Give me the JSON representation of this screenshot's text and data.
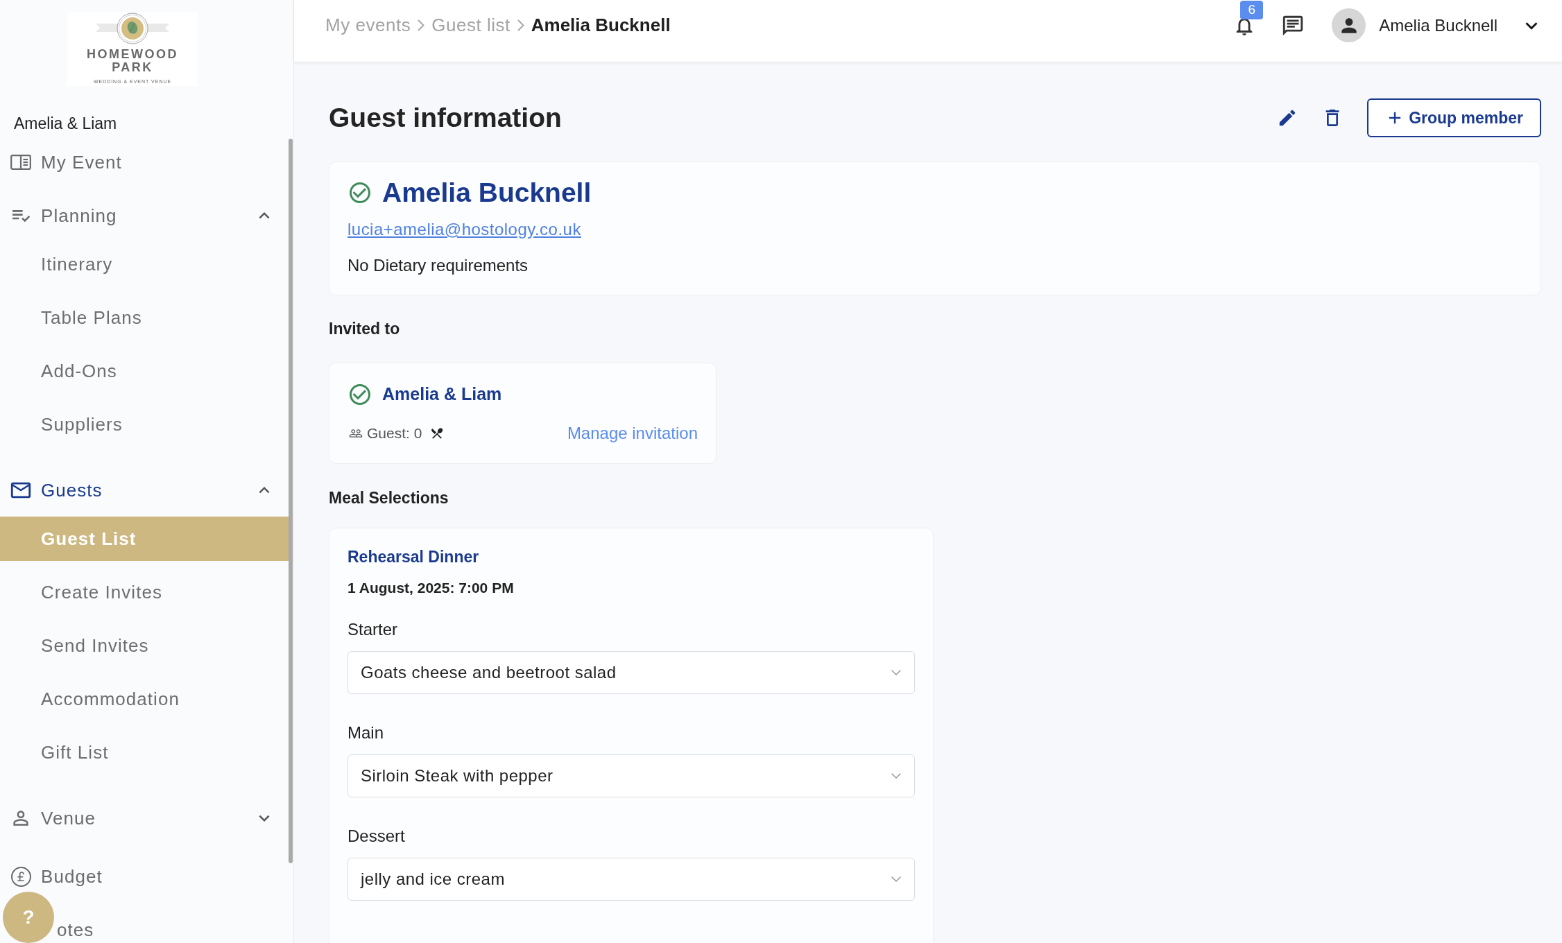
{
  "sidebar": {
    "logo": {
      "name_lines": [
        "HOMEWOOD",
        "PARK"
      ],
      "tagline": "WEDDING & EVENT VENUE"
    },
    "event_name": "Amelia & Liam",
    "items": [
      {
        "kind": "link",
        "label": "My Event",
        "selected": false
      },
      {
        "kind": "group",
        "label": "Planning",
        "selected": false,
        "expanded": true,
        "children": [
          {
            "label": "Itinerary",
            "selected": false
          },
          {
            "label": "Table Plans",
            "selected": false
          },
          {
            "label": "Add-Ons",
            "selected": false
          },
          {
            "label": "Suppliers",
            "selected": false
          }
        ]
      },
      {
        "kind": "group",
        "label": "Guests",
        "selected": true,
        "expanded": true,
        "children": [
          {
            "label": "Guest List",
            "selected": true
          },
          {
            "label": "Create Invites",
            "selected": false
          },
          {
            "label": "Send Invites",
            "selected": false
          },
          {
            "label": "Accommodation",
            "selected": false
          },
          {
            "label": "Gift List",
            "selected": false
          }
        ]
      },
      {
        "kind": "group",
        "label": "Venue",
        "selected": false,
        "expanded": false
      },
      {
        "kind": "link",
        "label": "Budget",
        "selected": false
      },
      {
        "kind": "covered",
        "label": "otes",
        "selected": false
      }
    ],
    "help_button": {
      "label": "?"
    }
  },
  "header": {
    "breadcrumb": [
      {
        "label": "My events",
        "current": false
      },
      {
        "label": "Guest list",
        "current": false
      },
      {
        "label": "Amelia Bucknell",
        "current": true
      }
    ],
    "notification_count": "6",
    "user_name": "Amelia Bucknell"
  },
  "page": {
    "title": "Guest information",
    "add_button": "Group member"
  },
  "guest": {
    "name": "Amelia Bucknell",
    "confirmed": true,
    "email": "lucia+amelia@hostology.co.uk",
    "dietary": "No Dietary requirements"
  },
  "invited_to": {
    "heading": "Invited to",
    "invitations": [
      {
        "name": "Amelia & Liam",
        "confirmed": true,
        "guest_count": "Guest: 0",
        "action": "Manage invitation"
      }
    ]
  },
  "meal_selections": {
    "heading": "Meal Selections",
    "events": [
      {
        "name": "Rehearsal Dinner",
        "datetime": "1 August, 2025: 7:00 PM",
        "courses": [
          {
            "label": "Starter",
            "value": "Goats cheese and beetroot salad"
          },
          {
            "label": "Main",
            "value": "Sirloin Steak with pepper"
          },
          {
            "label": "Dessert",
            "value": "jelly and ice cream"
          }
        ]
      }
    ]
  }
}
